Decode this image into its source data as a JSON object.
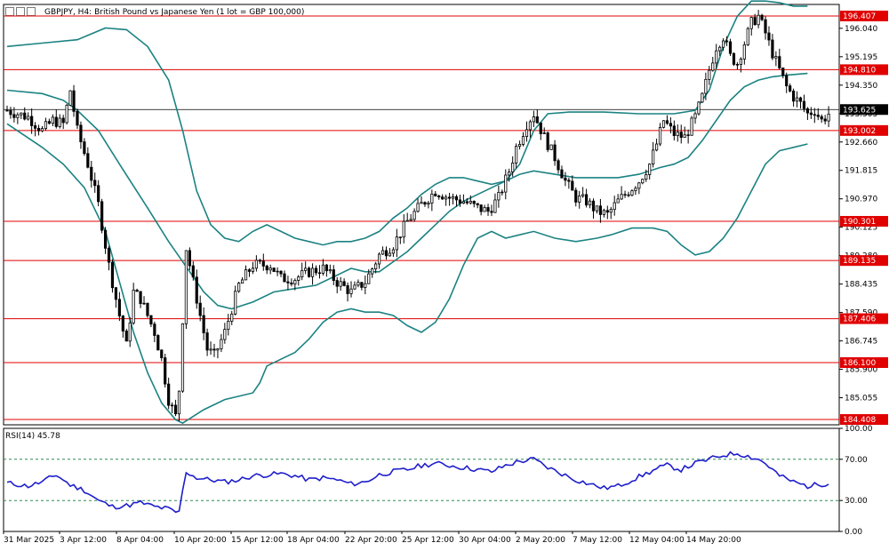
{
  "header": {
    "title": "GBPJPY, H4: British Pound vs Japanese Yen (1 lot = GBP 100,000)",
    "icons": [
      "chart-window-icon",
      "candles-icon",
      "menu-icon"
    ]
  },
  "colors": {
    "candle": "#000000",
    "bollinger": "#1c8282",
    "level": "#e00000",
    "level_label_bg": "#e00000",
    "current_price_bg": "#000000",
    "rsi": "#1e1ecc",
    "rsi_level": "#2e8b57",
    "frame": "#000000"
  },
  "chart_data": [
    {
      "type": "candlestick",
      "title": "GBPJPY, H4: British Pound vs Japanese Yen (1 lot = GBP 100,000)",
      "ylim": [
        184.25,
        196.75
      ],
      "y_ticks": [
        196.04,
        195.195,
        194.35,
        193.505,
        192.66,
        191.815,
        190.97,
        190.125,
        189.28,
        188.435,
        187.59,
        186.745,
        185.9,
        185.055
      ],
      "x_tick_labels": [
        "31 Mar 2025",
        "3 Apr 12:00",
        "8 Apr 04:00",
        "10 Apr 20:00",
        "15 Apr 12:00",
        "18 Apr 04:00",
        "22 Apr 20:00",
        "25 Apr 12:00",
        "30 Apr 04:00",
        "2 May 20:00",
        "7 May 12:00",
        "12 May 04:00",
        "14 May 20:00"
      ],
      "horizontal_levels": [
        196.407,
        194.81,
        193.002,
        190.301,
        189.135,
        187.406,
        186.1,
        184.408
      ],
      "current_price": 193.625,
      "close_path": [
        [
          0,
          193.6
        ],
        [
          6,
          193.4
        ],
        [
          10,
          193.0
        ],
        [
          13,
          193.3
        ],
        [
          16,
          193.2
        ],
        [
          18,
          194.2
        ],
        [
          20,
          193.0
        ],
        [
          23,
          192.0
        ],
        [
          26,
          190.8
        ],
        [
          29,
          189.0
        ],
        [
          32,
          187.5
        ],
        [
          34,
          186.6
        ],
        [
          36,
          188.2
        ],
        [
          38,
          188.0
        ],
        [
          40,
          187.5
        ],
        [
          42,
          187.0
        ],
        [
          44,
          186.2
        ],
        [
          46,
          185.0
        ],
        [
          48,
          184.5
        ],
        [
          49,
          185.3
        ],
        [
          51,
          189.5
        ],
        [
          53,
          188.5
        ],
        [
          55,
          187.5
        ],
        [
          57,
          186.5
        ],
        [
          59,
          186.3
        ],
        [
          62,
          187.0
        ],
        [
          66,
          188.4
        ],
        [
          70,
          189.0
        ],
        [
          75,
          189.0
        ],
        [
          78,
          188.6
        ],
        [
          82,
          188.6
        ],
        [
          86,
          188.8
        ],
        [
          90,
          188.9
        ],
        [
          94,
          188.5
        ],
        [
          98,
          188.2
        ],
        [
          102,
          188.5
        ],
        [
          106,
          189.3
        ],
        [
          110,
          189.6
        ],
        [
          114,
          190.3
        ],
        [
          118,
          190.8
        ],
        [
          122,
          191.2
        ],
        [
          126,
          191.0
        ],
        [
          130,
          190.9
        ],
        [
          134,
          190.7
        ],
        [
          137,
          190.6
        ],
        [
          140,
          191.0
        ],
        [
          143,
          191.8
        ],
        [
          145,
          192.5
        ],
        [
          148,
          193.2
        ],
        [
          150,
          193.5
        ],
        [
          153,
          192.8
        ],
        [
          156,
          192.2
        ],
        [
          159,
          191.5
        ],
        [
          162,
          191.0
        ],
        [
          165,
          190.9
        ],
        [
          168,
          190.6
        ],
        [
          171,
          190.5
        ],
        [
          174,
          190.9
        ],
        [
          177,
          191.2
        ],
        [
          180,
          191.5
        ],
        [
          183,
          192.0
        ],
        [
          185,
          192.6
        ],
        [
          187,
          193.3
        ],
        [
          190,
          192.9
        ],
        [
          193,
          192.8
        ],
        [
          196,
          193.4
        ],
        [
          198,
          194.0
        ],
        [
          200,
          194.8
        ],
        [
          202,
          195.5
        ],
        [
          204,
          195.8
        ],
        [
          206,
          195.2
        ],
        [
          208,
          195.0
        ],
        [
          210,
          195.6
        ],
        [
          212,
          196.2
        ],
        [
          214,
          196.4
        ],
        [
          216,
          195.9
        ],
        [
          218,
          195.3
        ],
        [
          220,
          194.8
        ],
        [
          222,
          194.3
        ],
        [
          224,
          194.0
        ],
        [
          226,
          193.8
        ],
        [
          228,
          193.5
        ],
        [
          230,
          193.6
        ],
        [
          232,
          193.3
        ],
        [
          234,
          193.5
        ]
      ],
      "bollinger": {
        "upper": [
          [
            0,
            195.5
          ],
          [
            10,
            195.6
          ],
          [
            20,
            195.7
          ],
          [
            28,
            196.05
          ],
          [
            34,
            196.0
          ],
          [
            40,
            195.5
          ],
          [
            46,
            194.5
          ],
          [
            50,
            193.0
          ],
          [
            54,
            191.2
          ],
          [
            58,
            190.2
          ],
          [
            62,
            189.8
          ],
          [
            66,
            189.7
          ],
          [
            70,
            190.0
          ],
          [
            74,
            190.2
          ],
          [
            78,
            190.0
          ],
          [
            82,
            189.8
          ],
          [
            86,
            189.7
          ],
          [
            90,
            189.6
          ],
          [
            94,
            189.7
          ],
          [
            98,
            189.7
          ],
          [
            102,
            189.8
          ],
          [
            106,
            190.0
          ],
          [
            110,
            190.4
          ],
          [
            114,
            190.7
          ],
          [
            118,
            191.1
          ],
          [
            122,
            191.4
          ],
          [
            126,
            191.6
          ],
          [
            130,
            191.6
          ],
          [
            134,
            191.5
          ],
          [
            138,
            191.4
          ],
          [
            142,
            191.5
          ],
          [
            146,
            192.0
          ],
          [
            150,
            193.0
          ],
          [
            154,
            193.5
          ],
          [
            160,
            193.55
          ],
          [
            170,
            193.55
          ],
          [
            180,
            193.5
          ],
          [
            190,
            193.5
          ],
          [
            196,
            193.6
          ],
          [
            200,
            194.2
          ],
          [
            204,
            195.5
          ],
          [
            208,
            196.4
          ],
          [
            212,
            196.85
          ],
          [
            216,
            196.85
          ],
          [
            220,
            196.8
          ],
          [
            224,
            196.7
          ],
          [
            228,
            196.7
          ]
        ],
        "middle": [
          [
            0,
            194.2
          ],
          [
            10,
            194.1
          ],
          [
            16,
            193.9
          ],
          [
            20,
            193.6
          ],
          [
            26,
            193.0
          ],
          [
            32,
            192.0
          ],
          [
            40,
            190.7
          ],
          [
            46,
            189.7
          ],
          [
            52,
            188.8
          ],
          [
            56,
            188.2
          ],
          [
            60,
            187.8
          ],
          [
            64,
            187.7
          ],
          [
            70,
            187.9
          ],
          [
            76,
            188.2
          ],
          [
            82,
            188.3
          ],
          [
            88,
            188.4
          ],
          [
            94,
            188.7
          ],
          [
            98,
            188.9
          ],
          [
            102,
            188.8
          ],
          [
            106,
            188.8
          ],
          [
            110,
            189.1
          ],
          [
            114,
            189.4
          ],
          [
            118,
            189.8
          ],
          [
            122,
            190.2
          ],
          [
            126,
            190.6
          ],
          [
            130,
            190.9
          ],
          [
            134,
            191.1
          ],
          [
            138,
            191.3
          ],
          [
            142,
            191.5
          ],
          [
            146,
            191.7
          ],
          [
            150,
            191.8
          ],
          [
            156,
            191.7
          ],
          [
            162,
            191.6
          ],
          [
            168,
            191.6
          ],
          [
            174,
            191.6
          ],
          [
            180,
            191.7
          ],
          [
            186,
            191.9
          ],
          [
            190,
            192.0
          ],
          [
            194,
            192.2
          ],
          [
            198,
            192.7
          ],
          [
            202,
            193.3
          ],
          [
            206,
            193.9
          ],
          [
            210,
            194.3
          ],
          [
            214,
            194.5
          ],
          [
            218,
            194.6
          ],
          [
            222,
            194.65
          ],
          [
            228,
            194.7
          ]
        ],
        "lower": [
          [
            0,
            193.2
          ],
          [
            10,
            192.5
          ],
          [
            16,
            192.0
          ],
          [
            22,
            191.3
          ],
          [
            28,
            190.0
          ],
          [
            32,
            188.5
          ],
          [
            36,
            187.0
          ],
          [
            40,
            185.8
          ],
          [
            44,
            184.9
          ],
          [
            48,
            184.4
          ],
          [
            50,
            184.3
          ],
          [
            56,
            184.7
          ],
          [
            62,
            185.0
          ],
          [
            70,
            185.2
          ],
          [
            72,
            185.5
          ],
          [
            74,
            186.0
          ],
          [
            78,
            186.2
          ],
          [
            82,
            186.4
          ],
          [
            86,
            186.8
          ],
          [
            90,
            187.3
          ],
          [
            94,
            187.6
          ],
          [
            98,
            187.7
          ],
          [
            102,
            187.6
          ],
          [
            106,
            187.6
          ],
          [
            110,
            187.5
          ],
          [
            114,
            187.2
          ],
          [
            118,
            187.0
          ],
          [
            122,
            187.3
          ],
          [
            126,
            188.0
          ],
          [
            130,
            189.0
          ],
          [
            134,
            189.8
          ],
          [
            138,
            190.0
          ],
          [
            142,
            189.8
          ],
          [
            146,
            189.9
          ],
          [
            150,
            190.0
          ],
          [
            156,
            189.8
          ],
          [
            162,
            189.7
          ],
          [
            168,
            189.8
          ],
          [
            172,
            189.9
          ],
          [
            178,
            190.1
          ],
          [
            184,
            190.1
          ],
          [
            188,
            190.0
          ],
          [
            192,
            189.6
          ],
          [
            196,
            189.3
          ],
          [
            200,
            189.4
          ],
          [
            204,
            189.8
          ],
          [
            208,
            190.4
          ],
          [
            212,
            191.2
          ],
          [
            216,
            192.0
          ],
          [
            220,
            192.4
          ],
          [
            224,
            192.5
          ],
          [
            228,
            192.6
          ]
        ]
      }
    },
    {
      "type": "line",
      "title": "RSI(14) 45.78",
      "ylim": [
        0,
        100
      ],
      "y_ticks": [
        100.0,
        70.0,
        30.0,
        0.0
      ],
      "levels": [
        70,
        30
      ],
      "series": [
        {
          "values": [
            [
              0,
              47
            ],
            [
              6,
              44
            ],
            [
              10,
              48
            ],
            [
              14,
              55
            ],
            [
              18,
              45
            ],
            [
              22,
              40
            ],
            [
              26,
              30
            ],
            [
              30,
              24
            ],
            [
              34,
              25
            ],
            [
              38,
              28
            ],
            [
              42,
              24
            ],
            [
              46,
              22
            ],
            [
              48,
              18
            ],
            [
              49,
              20
            ],
            [
              51,
              58
            ],
            [
              54,
              52
            ],
            [
              58,
              50
            ],
            [
              62,
              48
            ],
            [
              66,
              50
            ],
            [
              70,
              54
            ],
            [
              74,
              55
            ],
            [
              78,
              56
            ],
            [
              82,
              54
            ],
            [
              86,
              50
            ],
            [
              90,
              52
            ],
            [
              94,
              50
            ],
            [
              98,
              46
            ],
            [
              102,
              48
            ],
            [
              106,
              55
            ],
            [
              110,
              58
            ],
            [
              114,
              60
            ],
            [
              118,
              64
            ],
            [
              122,
              66
            ],
            [
              126,
              64
            ],
            [
              130,
              62
            ],
            [
              134,
              60
            ],
            [
              138,
              58
            ],
            [
              142,
              64
            ],
            [
              146,
              68
            ],
            [
              150,
              70
            ],
            [
              154,
              62
            ],
            [
              158,
              56
            ],
            [
              162,
              50
            ],
            [
              166,
              46
            ],
            [
              170,
              42
            ],
            [
              174,
              44
            ],
            [
              178,
              50
            ],
            [
              182,
              56
            ],
            [
              186,
              62
            ],
            [
              188,
              64
            ],
            [
              192,
              60
            ],
            [
              196,
              66
            ],
            [
              200,
              70
            ],
            [
              204,
              74
            ],
            [
              208,
              76
            ],
            [
              212,
              72
            ],
            [
              214,
              70
            ],
            [
              216,
              66
            ],
            [
              218,
              60
            ],
            [
              220,
              54
            ],
            [
              224,
              48
            ],
            [
              228,
              44
            ],
            [
              232,
              46
            ],
            [
              234,
              45.78
            ]
          ]
        }
      ]
    }
  ]
}
